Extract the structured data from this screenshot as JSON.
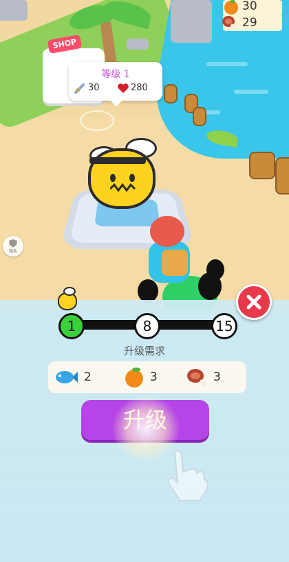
{
  "resources": {
    "orange": "30",
    "meat": "29",
    "orange_icon": "orange-icon",
    "meat_icon": "meat-icon"
  },
  "shop": {
    "sign": "SHOP"
  },
  "tooltip": {
    "level_label": "等级 1",
    "attack": "30",
    "health": "280"
  },
  "side_button": {
    "label": "隐私"
  },
  "progress": {
    "current_level": "1",
    "milestones": [
      "1",
      "8",
      "15"
    ]
  },
  "requirements": {
    "title": "升级需求",
    "items": [
      {
        "icon": "fish-icon",
        "count": "2"
      },
      {
        "icon": "orange-icon",
        "count": "3"
      },
      {
        "icon": "meat-icon",
        "count": "3"
      }
    ]
  },
  "upgrade_button": {
    "label": "升级"
  },
  "colors": {
    "accent": "#b545e6",
    "close": "#e8394b",
    "progress_done": "#3ad03c"
  }
}
